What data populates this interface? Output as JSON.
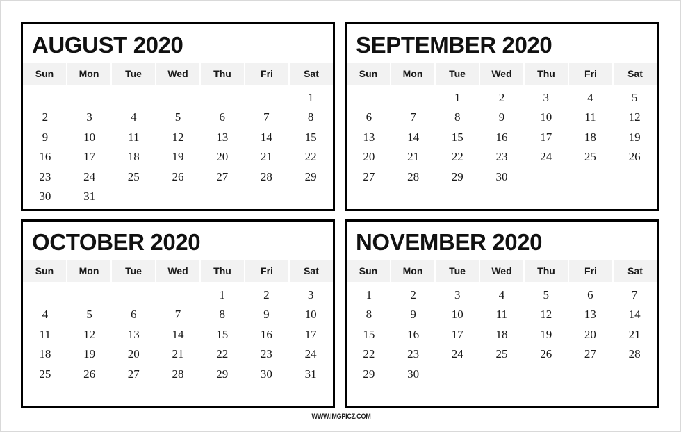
{
  "page": {
    "watermark": "WWW.IMGPICZ.COM"
  },
  "weekday_headers": [
    "Sun",
    "Mon",
    "Tue",
    "Wed",
    "Thu",
    "Fri",
    "Sat"
  ],
  "months": [
    {
      "title": "AUGUST 2020",
      "name": "August",
      "year": "2020",
      "start_weekday_index": 6,
      "num_days": 31,
      "days": [
        "",
        "",
        "",
        "",
        "",
        "",
        "1",
        "2",
        "3",
        "4",
        "5",
        "6",
        "7",
        "8",
        "9",
        "10",
        "11",
        "12",
        "13",
        "14",
        "15",
        "16",
        "17",
        "18",
        "19",
        "20",
        "21",
        "22",
        "23",
        "24",
        "25",
        "26",
        "27",
        "28",
        "29",
        "30",
        "31",
        "",
        "",
        "",
        "",
        ""
      ]
    },
    {
      "title": "SEPTEMBER 2020",
      "name": "September",
      "year": "2020",
      "start_weekday_index": 2,
      "num_days": 30,
      "days": [
        "",
        "",
        "1",
        "2",
        "3",
        "4",
        "5",
        "6",
        "7",
        "8",
        "9",
        "10",
        "11",
        "12",
        "13",
        "14",
        "15",
        "16",
        "17",
        "18",
        "19",
        "20",
        "21",
        "22",
        "23",
        "24",
        "25",
        "26",
        "27",
        "28",
        "29",
        "30",
        "",
        "",
        ""
      ]
    },
    {
      "title": "OCTOBER 2020",
      "name": "October",
      "year": "2020",
      "start_weekday_index": 4,
      "num_days": 31,
      "days": [
        "",
        "",
        "",
        "",
        "1",
        "2",
        "3",
        "4",
        "5",
        "6",
        "7",
        "8",
        "9",
        "10",
        "11",
        "12",
        "13",
        "14",
        "15",
        "16",
        "17",
        "18",
        "19",
        "20",
        "21",
        "22",
        "23",
        "24",
        "25",
        "26",
        "27",
        "28",
        "29",
        "30",
        "31"
      ]
    },
    {
      "title": "NOVEMBER 2020",
      "name": "November",
      "year": "2020",
      "start_weekday_index": 0,
      "num_days": 30,
      "days": [
        "1",
        "2",
        "3",
        "4",
        "5",
        "6",
        "7",
        "8",
        "9",
        "10",
        "11",
        "12",
        "13",
        "14",
        "15",
        "16",
        "17",
        "18",
        "19",
        "20",
        "21",
        "22",
        "23",
        "24",
        "25",
        "26",
        "27",
        "28",
        "29",
        "30",
        "",
        "",
        "",
        "",
        ""
      ]
    }
  ]
}
